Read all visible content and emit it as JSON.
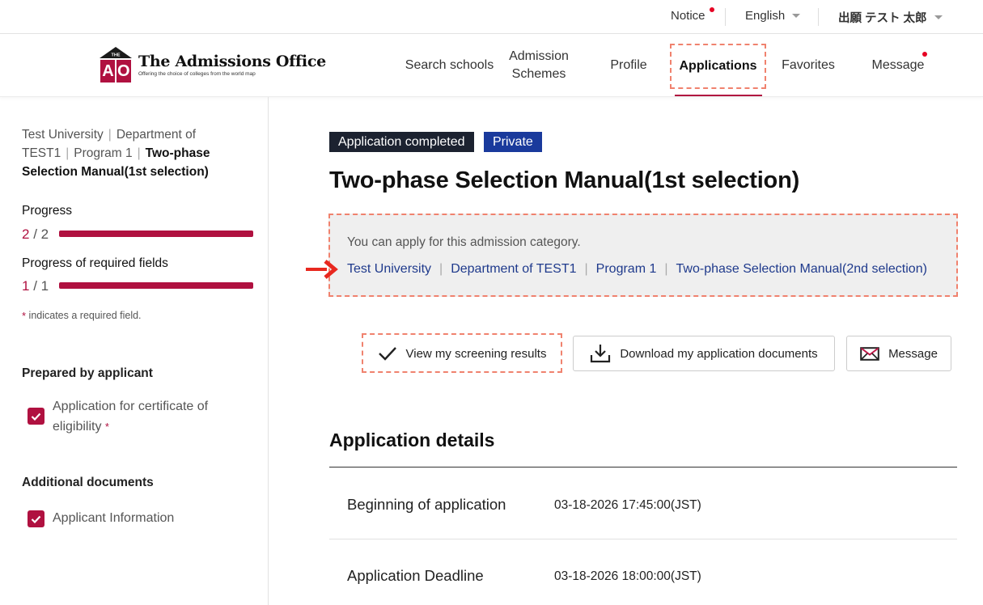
{
  "utility": {
    "notice": "Notice",
    "language": "English",
    "user": "出願 テスト 太郎"
  },
  "brand": {
    "title": "The Admissions Office",
    "tagline": "Offering the choice of colleges from the world map",
    "mark_letters": "AO",
    "mark_small": "THE"
  },
  "nav": {
    "search": "Search schools",
    "admission_line1": "Admission",
    "admission_line2": "Schemes",
    "profile": "Profile",
    "applications": "Applications",
    "favorites": "Favorites",
    "message": "Message"
  },
  "sidebar": {
    "breadcrumb": [
      "Test University",
      "Department of TEST1",
      "Program 1",
      "Two-phase Selection Manual(1st selection)"
    ],
    "progress_label": "Progress",
    "progress_current": "2",
    "progress_total": "/ 2",
    "progress_ratio": 1.0,
    "required_label": "Progress of required fields",
    "required_current": "1",
    "required_total": "/ 1",
    "required_ratio": 1.0,
    "required_star": "*",
    "required_note": "indicates a required field.",
    "prepared_heading": "Prepared by applicant",
    "prepared_item_line1": "Application for certificate of",
    "prepared_item_line2": "eligibility",
    "prepared_item_star": "*",
    "additional_heading": "Additional documents",
    "additional_item": "Applicant Information"
  },
  "main": {
    "badge_status": "Application completed",
    "badge_visibility": "Private",
    "title": "Two-phase Selection Manual(1st selection)",
    "notice_text": "You can apply for this admission category.",
    "notice_links": [
      "Test University",
      "Department of TEST1",
      "Program 1",
      "Two-phase Selection Manual(2nd selection)"
    ],
    "btn_results": "View my screening results",
    "btn_download": "Download my application documents",
    "btn_message": "Message",
    "section_title": "Application details",
    "rows": [
      {
        "label": "Beginning of application",
        "value": "03-18-2026 17:45:00(JST)"
      },
      {
        "label": "Application Deadline",
        "value": "03-18-2026 18:00:00(JST)"
      }
    ]
  },
  "colors": {
    "accent": "#b01140",
    "link": "#1f3a8c",
    "badge_dark": "#1c2230",
    "badge_blue": "#1a3a9c",
    "highlight": "#f0826e",
    "arrow": "#e8281f"
  }
}
